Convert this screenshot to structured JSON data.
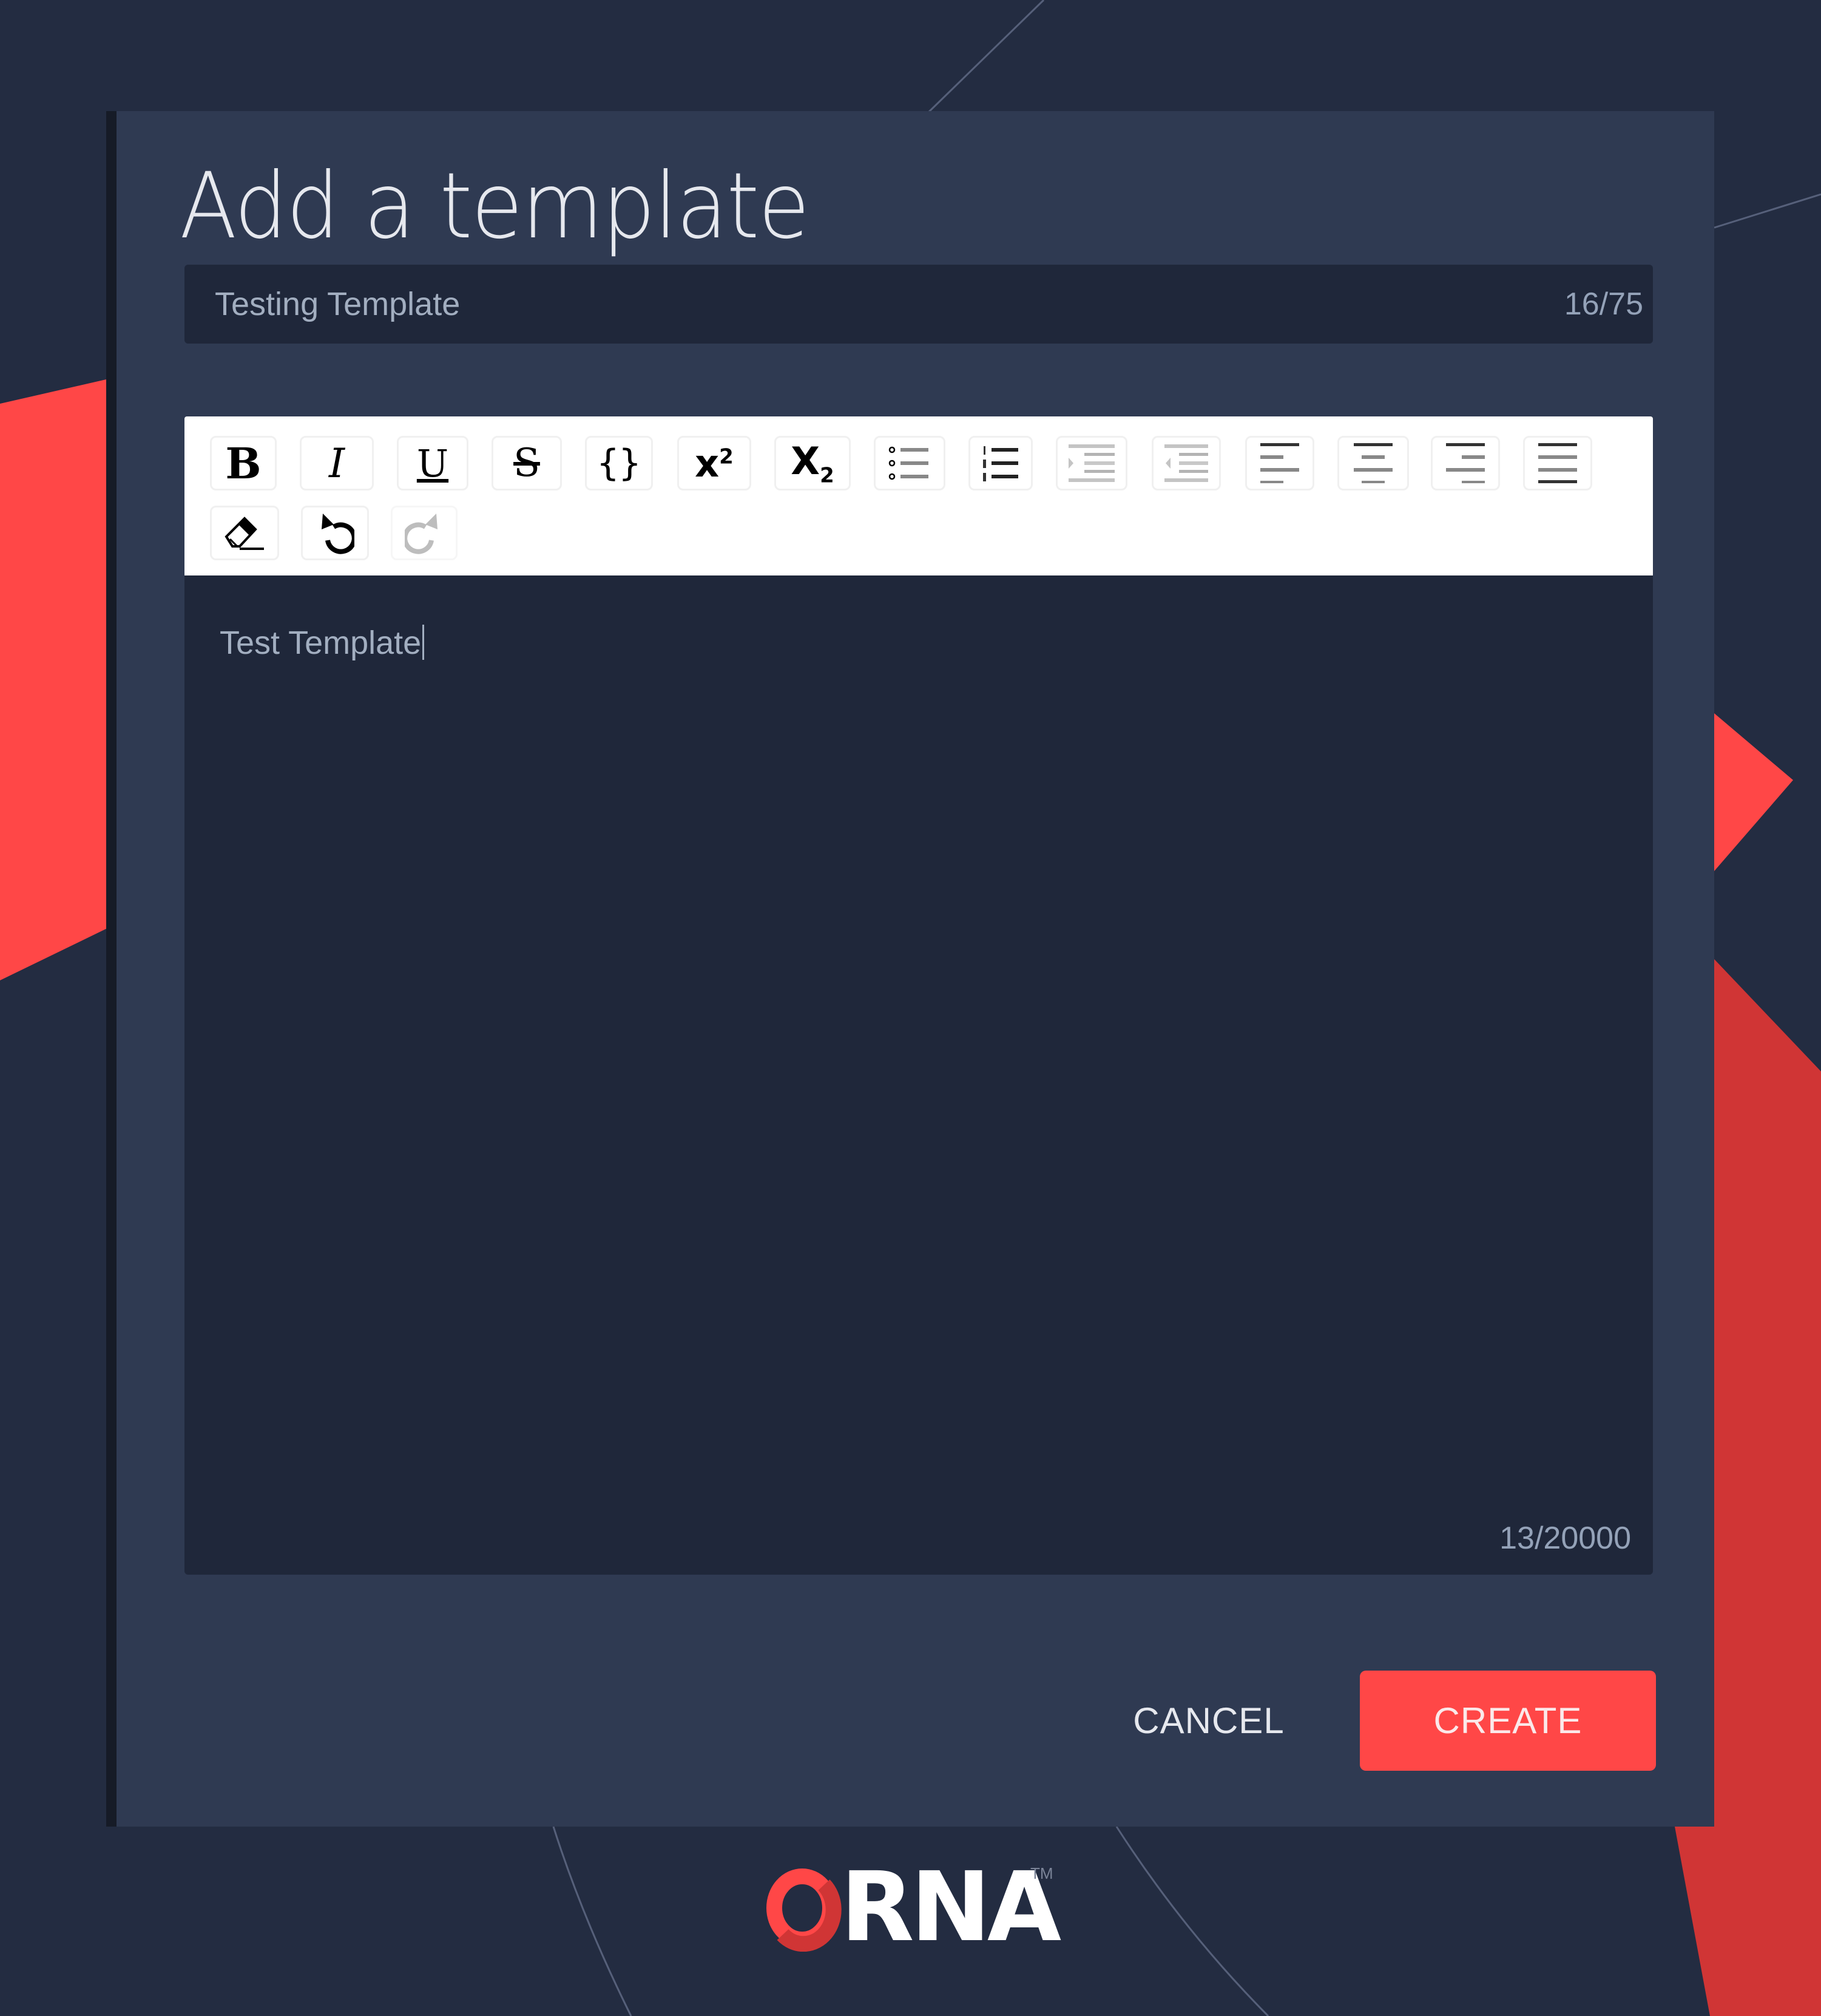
{
  "modal": {
    "title": "Add a template",
    "name_field": {
      "value": "Testing Template",
      "counter": "16/75"
    },
    "editor": {
      "toolbar": {
        "row1": [
          {
            "icon": "bold-icon",
            "label": "B"
          },
          {
            "icon": "italic-icon",
            "label": "I"
          },
          {
            "icon": "underline-icon",
            "label": "U"
          },
          {
            "icon": "strikethrough-icon",
            "label": "S"
          },
          {
            "icon": "code-braces-icon",
            "label": "{ }"
          },
          {
            "icon": "superscript-icon",
            "label": "x²"
          },
          {
            "icon": "subscript-icon",
            "label": "x₂"
          },
          {
            "icon": "bulleted-list-icon",
            "label": ""
          },
          {
            "icon": "numbered-list-icon",
            "label": ""
          },
          {
            "icon": "indent-icon",
            "label": ""
          },
          {
            "icon": "outdent-icon",
            "label": ""
          },
          {
            "icon": "align-left-icon",
            "label": ""
          },
          {
            "icon": "align-center-icon",
            "label": ""
          },
          {
            "icon": "align-right-icon",
            "label": ""
          },
          {
            "icon": "align-justify-icon",
            "label": ""
          }
        ],
        "row2": [
          {
            "icon": "eraser-icon",
            "label": "Clear formatting"
          },
          {
            "icon": "undo-icon",
            "label": "Undo"
          },
          {
            "icon": "redo-icon",
            "label": "Redo",
            "disabled": true
          }
        ]
      },
      "content": "Test Template",
      "counter": "13/20000"
    },
    "buttons": {
      "cancel": "CANCEL",
      "create": "CREATE"
    }
  },
  "brand": {
    "logo_text": "RNA",
    "logo_full": "ORNA",
    "trademark": "TM"
  },
  "colors": {
    "accent": "#ff4747",
    "accent_dark": "#d03535",
    "background": "#232c41",
    "modal": "#2f3a52",
    "field": "#1f273a",
    "text": "#e6e8ee",
    "muted_text": "#a2aec0"
  }
}
